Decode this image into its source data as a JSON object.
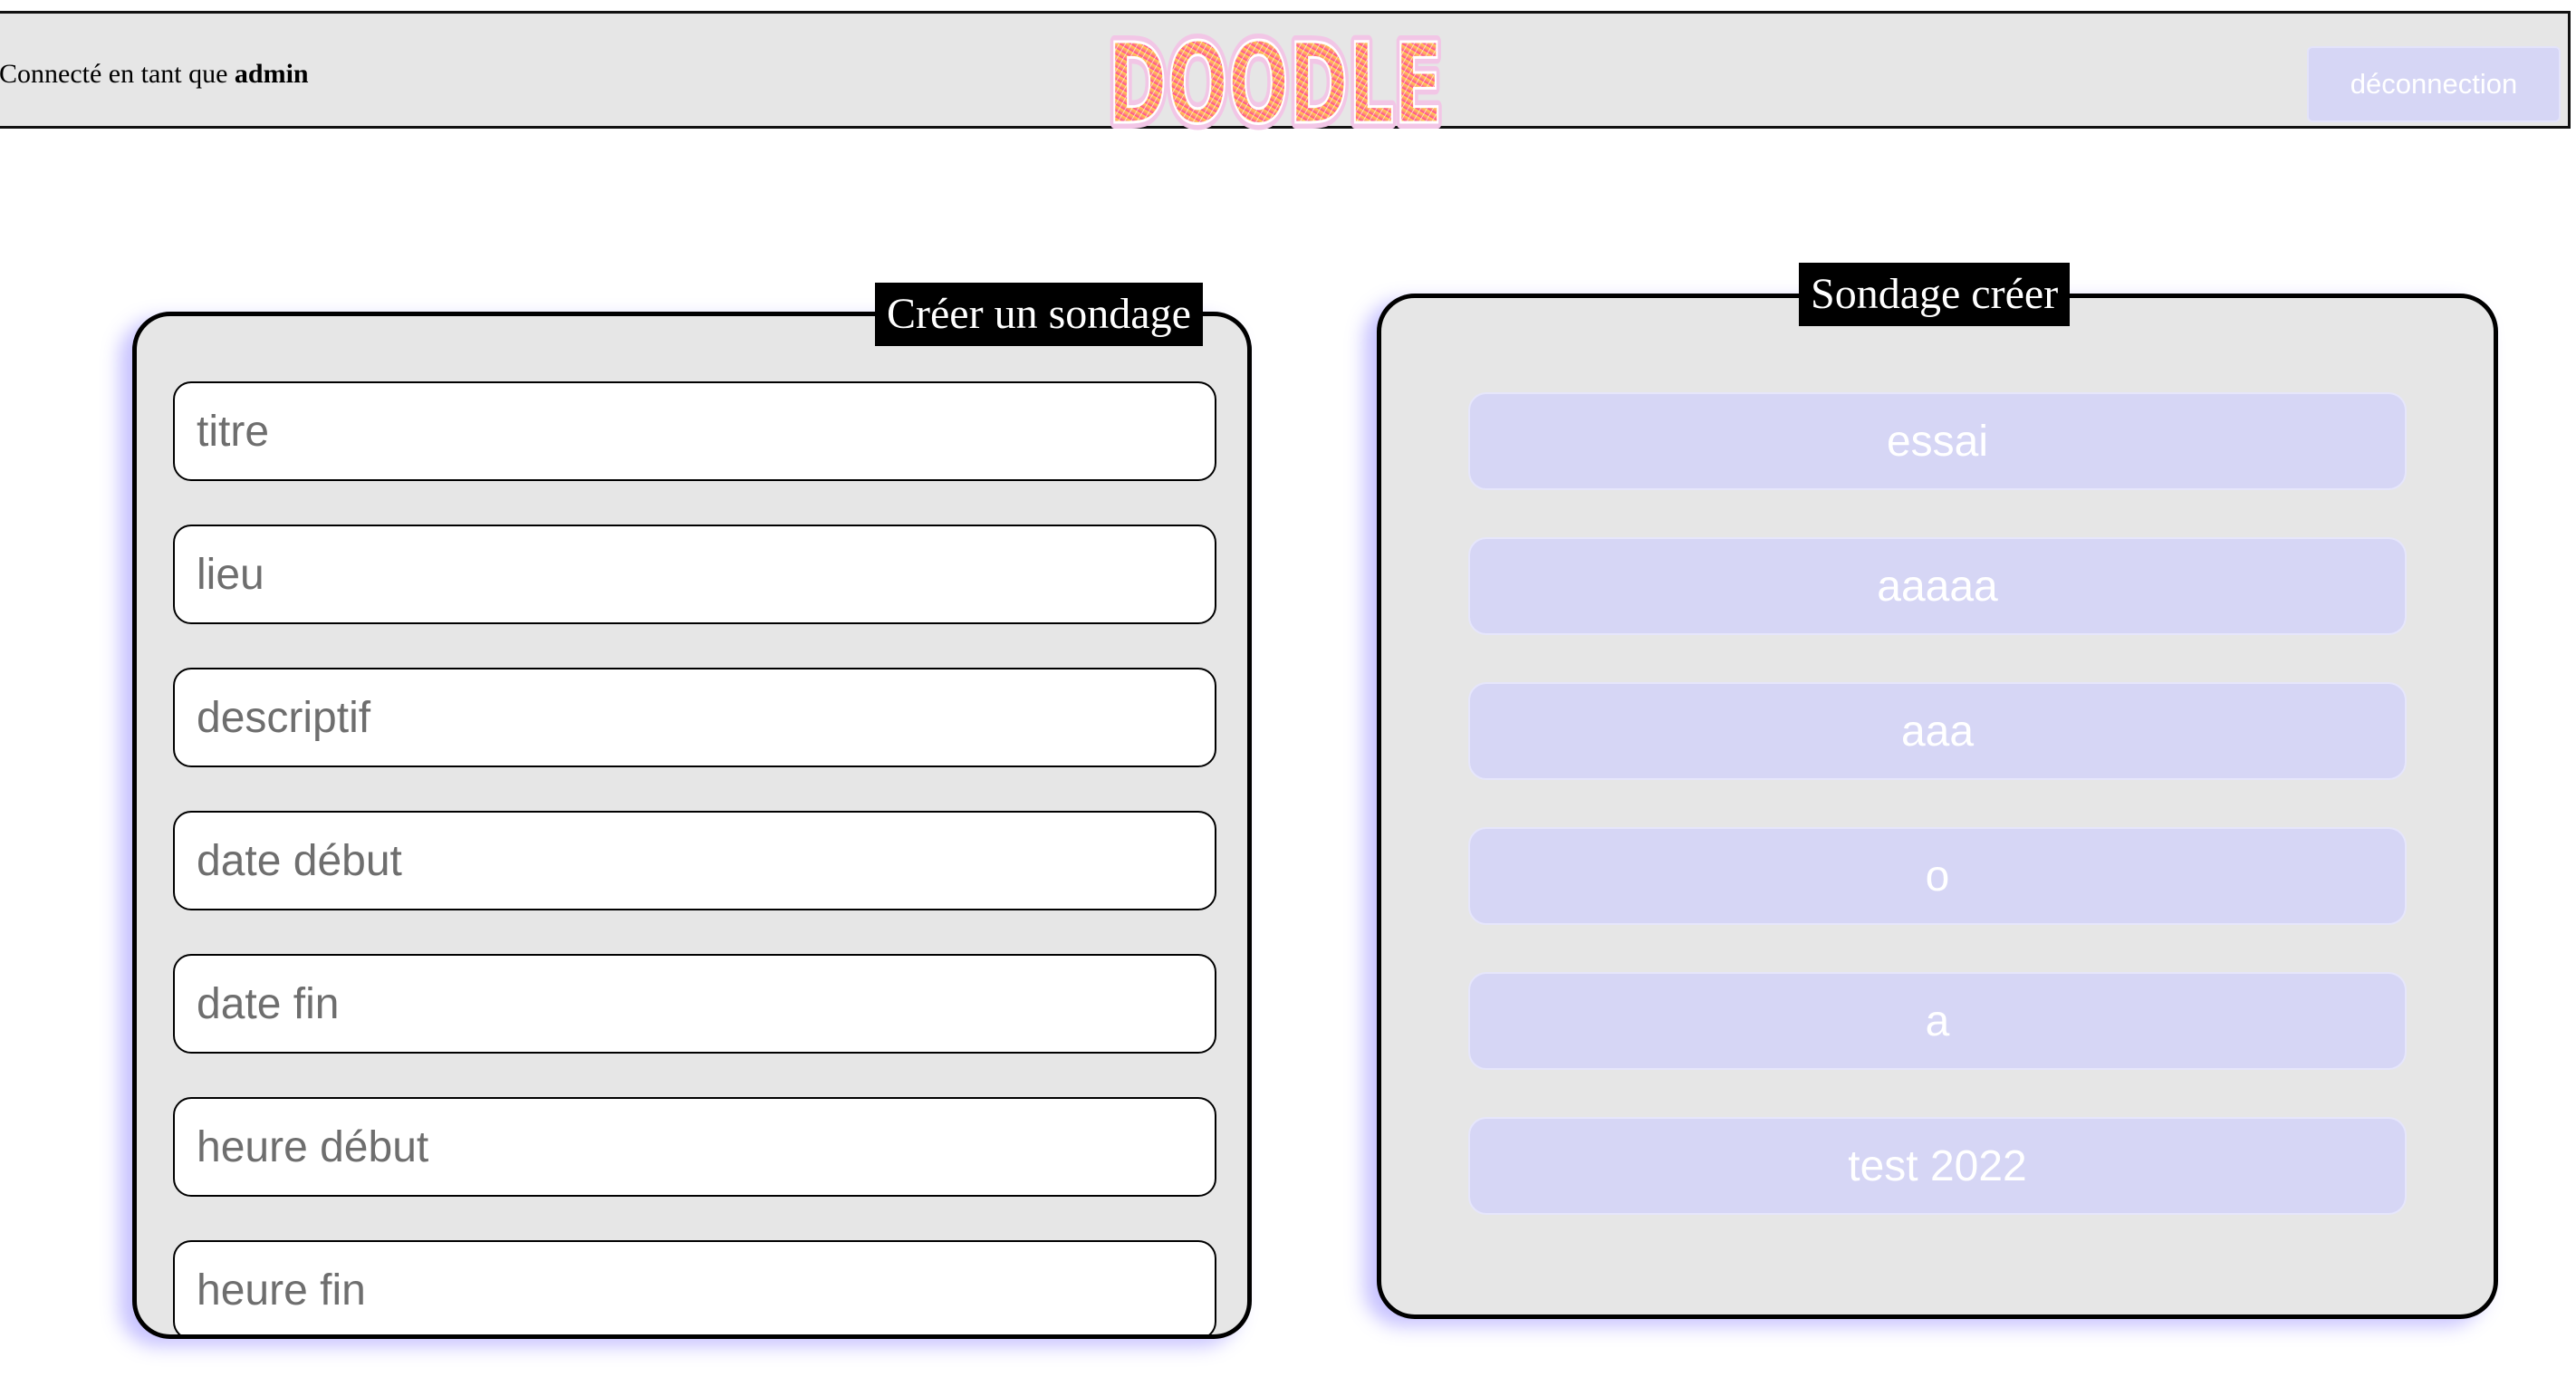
{
  "header": {
    "login_prefix": "Connecté en tant que ",
    "username": "admin",
    "logo_text": "DOODLE",
    "logout_label": "déconnection"
  },
  "create_panel": {
    "title": "Créer un sondage",
    "fields": [
      {
        "placeholder": "titre",
        "value": ""
      },
      {
        "placeholder": "lieu",
        "value": ""
      },
      {
        "placeholder": "descriptif",
        "value": ""
      },
      {
        "placeholder": "date début",
        "value": ""
      },
      {
        "placeholder": "date fin",
        "value": ""
      },
      {
        "placeholder": "heure début",
        "value": ""
      },
      {
        "placeholder": "heure fin",
        "value": ""
      }
    ]
  },
  "created_panel": {
    "title": "Sondage créer",
    "polls": [
      "essai",
      "aaaaa",
      "aaa",
      "o",
      "a",
      "test 2022"
    ]
  },
  "colors": {
    "header_bg": "#e6e6e6",
    "panel_bg": "#e6e6e6",
    "button_bg": "#d6d6f5",
    "label_bg": "#000000",
    "logo_gradient_top": "#ffd84a",
    "logo_gradient_bottom": "#ff3fa0"
  }
}
